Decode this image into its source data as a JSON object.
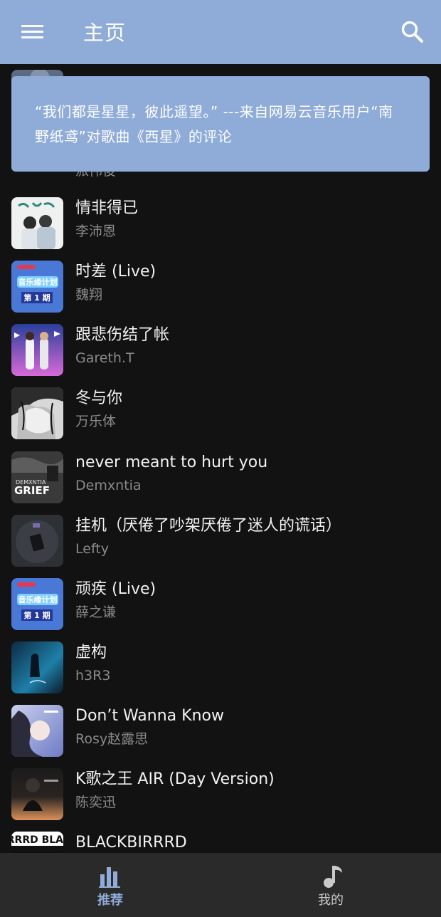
{
  "appbar": {
    "title": "主页",
    "menu_icon": "hamburger-menu-icon",
    "search_icon": "search-icon",
    "color": "#8fabd8"
  },
  "quote": {
    "text": "“我们都是星星，彼此遥望。” ---来自网易云音乐用户“南野纸鸢”对歌曲《西星》的评论"
  },
  "songs": [
    {
      "title": "",
      "artist": "派伟俊"
    },
    {
      "title": "情非得已",
      "artist": "李沛恩"
    },
    {
      "title": "时差 (Live)",
      "artist": "魏翔"
    },
    {
      "title": "跟悲伤结了帐",
      "artist": "Gareth.T"
    },
    {
      "title": "冬与你",
      "artist": "万乐体"
    },
    {
      "title": "never meant to hurt you",
      "artist": "Demxntia"
    },
    {
      "title": "挂机（厌倦了吵架厌倦了迷人的谎话）",
      "artist": "Lefty"
    },
    {
      "title": "顽疾 (Live)",
      "artist": "薛之谦"
    },
    {
      "title": "虚构",
      "artist": "h3R3"
    },
    {
      "title": "Don’t Wanna Know",
      "artist": "Rosy赵露思"
    },
    {
      "title": "K歌之王 AIR (Day Version)",
      "artist": "陈奕迅"
    },
    {
      "title": "BLACKBIRRRD",
      "artist": ""
    }
  ],
  "covers": {
    "show1_text": "音乐缘计划",
    "show1_sub": "第 1 期",
    "grief_brand": "DEMXNTIA",
    "grief_word": "GRIEF",
    "blackbird_text": "BIRRRD BLACK"
  },
  "bottom_nav": {
    "recommend_label": "推荐",
    "recommend_icon": "bar-chart-icon",
    "mine_label": "我的",
    "mine_icon": "music-note-icon",
    "active_color": "#8fabd8"
  }
}
